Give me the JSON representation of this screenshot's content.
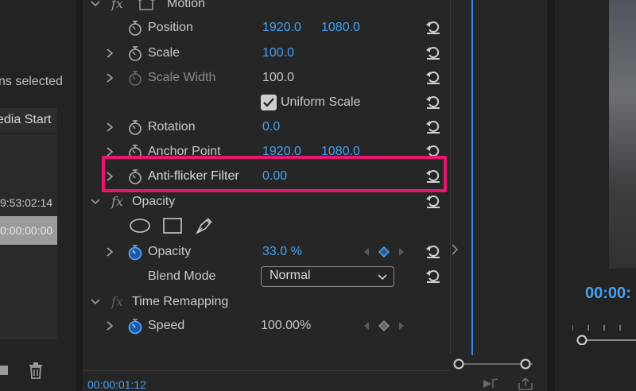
{
  "project_panel": {
    "selection_text": "ns selected",
    "column_header": "edia Start",
    "timecode_1": "9:53:02:14",
    "timecode_2": "0:00:00:00"
  },
  "effect_controls": {
    "sections": {
      "motion": "Motion",
      "opacity": "Opacity",
      "time_remapping": "Time Remapping"
    },
    "properties": {
      "position": {
        "label": "Position",
        "x": "1920.0",
        "y": "1080.0"
      },
      "scale": {
        "label": "Scale",
        "value": "100.0"
      },
      "scale_width": {
        "label": "Scale Width",
        "value": "100.0"
      },
      "uniform_scale": {
        "label": "Uniform Scale",
        "checked": true
      },
      "rotation": {
        "label": "Rotation",
        "value": "0.0"
      },
      "anchor_point": {
        "label": "Anchor Point",
        "x": "1920.0",
        "y": "1080.0"
      },
      "anti_flicker": {
        "label": "Anti-flicker Filter",
        "value": "0.00"
      },
      "opacity": {
        "label": "Opacity",
        "value": "33.0 %"
      },
      "blend_mode": {
        "label": "Blend Mode",
        "value": "Normal"
      },
      "speed": {
        "label": "Speed",
        "value": "100.00%"
      }
    },
    "fx_glyph": "fx",
    "footer_timecode": "00:00:01:12"
  },
  "program_monitor": {
    "timecode": "00:00:"
  },
  "colors": {
    "accent_blue": "#46a1f2",
    "highlight_pink": "#e8176e",
    "panel_bg": "#262626"
  }
}
